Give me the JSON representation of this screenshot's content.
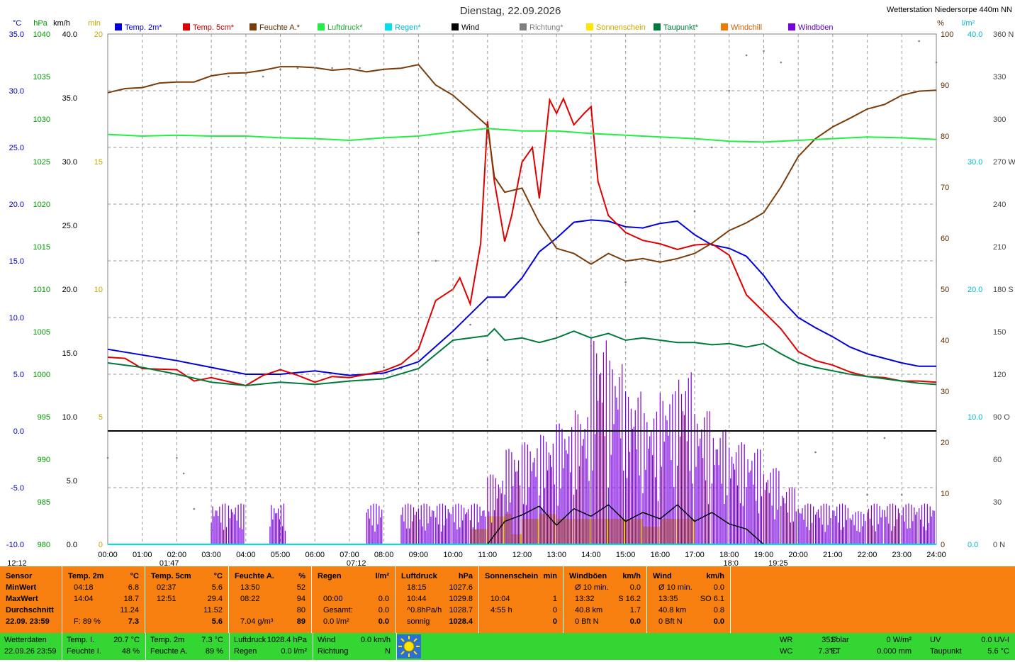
{
  "title": "Dienstag, 22.09.2026",
  "station": "Wetterstation Niedersorpe 440m NN",
  "axis_units": {
    "temp": "°C",
    "pressure": "hPa",
    "wind": "km/h",
    "sun": "min",
    "humidity": "%",
    "rain": "l/m²",
    "direction": "N"
  },
  "axis_ticks": {
    "temp": [
      "35.0",
      "30.0",
      "25.0",
      "20.0",
      "15.0",
      "10.0",
      "5.0",
      "0.0",
      "-5.0",
      "-10.0"
    ],
    "pressure": [
      "1040",
      "1035",
      "1030",
      "1025",
      "1020",
      "1015",
      "1010",
      "1005",
      "1000",
      "995",
      "990",
      "985",
      "980"
    ],
    "wind": [
      "40.0",
      "35.0",
      "30.0",
      "25.0",
      "20.0",
      "15.0",
      "10.0",
      "5.0",
      "0.0"
    ],
    "sun": [
      "20",
      "15",
      "10",
      "5",
      "0"
    ],
    "humidity": [
      "100",
      "90",
      "80",
      "70",
      "60",
      "50",
      "40",
      "30",
      "20",
      "10",
      "0"
    ],
    "rain": [
      "40.0",
      "30.0",
      "20.0",
      "10.0",
      "0.0"
    ],
    "direction": [
      "360 N",
      "330",
      "300",
      "270 W",
      "240",
      "210",
      "180 S",
      "150",
      "120",
      "90 O",
      "60",
      "30",
      "0 N"
    ]
  },
  "legend": [
    {
      "name": "Temp. 2m*",
      "color": "#0000dd"
    },
    {
      "name": "Temp. 5cm*",
      "color": "#e00000"
    },
    {
      "name": "Feuchte A.*",
      "color": "#7a3c0a"
    },
    {
      "name": "Luftdruck*",
      "color": "#22ee44"
    },
    {
      "name": "Regen*",
      "color": "#00e0f0"
    },
    {
      "name": "Wind",
      "color": "#000000"
    },
    {
      "name": "Richtung*",
      "color": "#808080"
    },
    {
      "name": "Sonnenschein",
      "color": "#ffe600"
    },
    {
      "name": "Taupunkt*",
      "color": "#007a3a"
    },
    {
      "name": "Windchill",
      "color": "#f07a00"
    },
    {
      "name": "Windböen",
      "color": "#7a00e0"
    }
  ],
  "time_labels": [
    "00:00",
    "01:00",
    "02:00",
    "03:00",
    "04:00",
    "05:00",
    "06:00",
    "07:00",
    "08:00",
    "09:00",
    "10:00",
    "11:00",
    "12:00",
    "13:00",
    "14:00",
    "15:00",
    "16:00",
    "17:00",
    "18:00",
    "19:00",
    "20:00",
    "21:00",
    "22:00",
    "23:00",
    "24:00"
  ],
  "events": [
    {
      "label": "12:12",
      "hour": -2.2
    },
    {
      "label": "01:47",
      "hour": 1.78
    },
    {
      "label": "07:12",
      "hour": 7.2
    },
    {
      "label": "18:0",
      "hour": 18.05
    },
    {
      "label": "19:25",
      "hour": 19.42
    }
  ],
  "chart_data": {
    "type": "line",
    "x_range": [
      0,
      24
    ],
    "ranges": {
      "temp": [
        -10,
        35
      ],
      "pressure": [
        980,
        1040
      ],
      "wind": [
        0,
        40
      ],
      "sun": [
        0,
        20
      ],
      "humidity": [
        0,
        100
      ],
      "rain": [
        0,
        40
      ],
      "direction": [
        0,
        360
      ]
    },
    "series": [
      {
        "name": "Temp. 2m*",
        "axis": "temp",
        "color": "#0000dd",
        "x": [
          0,
          1,
          2,
          3,
          4,
          5,
          6,
          7,
          8,
          9,
          10,
          11,
          11.5,
          12,
          12.5,
          13,
          13.5,
          14,
          14.5,
          15,
          15.5,
          16,
          16.5,
          17,
          17.5,
          18,
          18.5,
          19,
          19.5,
          20,
          20.5,
          21,
          21.5,
          22,
          22.5,
          23,
          23.5,
          24
        ],
        "y": [
          7.2,
          6.7,
          6.2,
          5.6,
          5.0,
          5.0,
          5.3,
          4.9,
          5.1,
          6.1,
          8.8,
          11.8,
          11.8,
          13.5,
          15.8,
          17.0,
          18.4,
          18.6,
          18.5,
          18.0,
          17.9,
          18.3,
          18.5,
          17.3,
          16.4,
          16.1,
          15.4,
          13.7,
          11.6,
          10.0,
          9.1,
          8.3,
          7.4,
          6.8,
          6.4,
          6.0,
          5.7,
          5.7
        ]
      },
      {
        "name": "Temp. 5cm*",
        "axis": "temp",
        "color": "#e00000",
        "x": [
          0,
          0.5,
          1,
          2,
          2.5,
          3,
          4,
          4.5,
          5,
          5.5,
          6,
          6.5,
          7,
          8,
          8.5,
          9,
          9.5,
          10,
          10.2,
          10.5,
          10.8,
          11,
          11.2,
          11.5,
          11.7,
          12,
          12.3,
          12.5,
          12.8,
          13,
          13.2,
          13.5,
          13.8,
          14,
          14.2,
          14.5,
          15,
          15.5,
          16,
          16.5,
          17,
          17.5,
          18,
          18.5,
          19,
          19.5,
          20,
          20.5,
          21,
          21.5,
          22,
          22.5,
          23,
          23.5,
          24
        ],
        "y": [
          6.5,
          6.4,
          5.5,
          5.4,
          4.4,
          4.7,
          4.0,
          4.9,
          5.4,
          4.9,
          4.3,
          4.8,
          4.7,
          5.3,
          5.9,
          7.2,
          11.5,
          12.5,
          13.5,
          11.2,
          16.5,
          27.3,
          22.0,
          16.7,
          19.0,
          23.7,
          25.0,
          20.5,
          29.2,
          28.0,
          29.3,
          27.0,
          28.0,
          28.6,
          22.0,
          19.0,
          17.5,
          16.8,
          16.5,
          16.0,
          16.4,
          16.5,
          15.5,
          12.0,
          10.5,
          9.0,
          7.0,
          6.2,
          5.8,
          5.2,
          4.8,
          4.7,
          4.4,
          4.4,
          4.3
        ]
      },
      {
        "name": "Feuchte A.*",
        "axis": "humidity",
        "color": "#7a3c0a",
        "x": [
          0,
          0.5,
          1,
          1.5,
          2,
          2.5,
          3,
          3.5,
          4,
          4.5,
          5,
          5.5,
          6,
          6.5,
          7,
          7.5,
          8,
          8.5,
          9,
          9.5,
          10,
          10.5,
          11,
          11.2,
          11.5,
          12,
          12.5,
          13,
          13.5,
          14,
          14.5,
          15,
          15.5,
          16,
          16.5,
          17,
          17.5,
          18,
          18.5,
          19,
          19.5,
          20,
          20.5,
          21,
          21.5,
          22,
          22.5,
          23,
          23.5,
          24
        ],
        "y": [
          88.5,
          89.3,
          89.5,
          90.4,
          90.6,
          90.6,
          91.8,
          92.3,
          92.4,
          92.9,
          93.6,
          93.6,
          93.4,
          92.9,
          93.2,
          92.6,
          93.1,
          93.3,
          94.0,
          90.0,
          88.0,
          85.0,
          82.0,
          72.0,
          69.0,
          69.8,
          63.0,
          58.0,
          57.0,
          54.9,
          57.0,
          55.5,
          56.0,
          55.3,
          56.0,
          57.0,
          59.0,
          61.5,
          63.0,
          65.0,
          70.0,
          76.0,
          79.5,
          81.8,
          83.5,
          85.3,
          86.2,
          88.0,
          88.8,
          89.0
        ]
      },
      {
        "name": "Luftdruck*",
        "axis": "pressure",
        "color": "#22ee44",
        "x": [
          0,
          1,
          2,
          3,
          4,
          5,
          6,
          7,
          8,
          9,
          10,
          11,
          12,
          13,
          14,
          15,
          16,
          17,
          18,
          19,
          20,
          21,
          22,
          23,
          24
        ],
        "y": [
          1028.2,
          1028.0,
          1028.1,
          1028.0,
          1028.0,
          1027.8,
          1027.7,
          1027.5,
          1027.8,
          1028.0,
          1028.5,
          1028.9,
          1028.6,
          1028.6,
          1028.3,
          1028.1,
          1027.9,
          1027.7,
          1027.4,
          1027.3,
          1027.5,
          1027.7,
          1027.9,
          1027.8,
          1027.6
        ]
      },
      {
        "name": "Taupunkt*",
        "axis": "temp",
        "color": "#007a3a",
        "x": [
          0,
          1,
          2,
          3,
          4,
          5,
          6,
          7,
          8,
          9,
          10,
          11,
          11.2,
          11.5,
          12,
          12.5,
          13,
          13.5,
          14,
          14.5,
          15,
          15.5,
          16,
          16.5,
          17,
          17.5,
          18,
          18.5,
          19,
          19.5,
          20,
          20.5,
          21,
          21.5,
          22,
          22.5,
          23,
          23.5,
          24
        ],
        "y": [
          6.0,
          5.6,
          5.0,
          4.3,
          4.0,
          4.3,
          4.1,
          4.4,
          4.6,
          5.5,
          8.0,
          8.4,
          9.0,
          8.0,
          8.2,
          7.8,
          8.2,
          8.8,
          8.2,
          8.6,
          8.0,
          8.2,
          8.0,
          7.8,
          7.8,
          7.6,
          7.7,
          7.4,
          7.7,
          6.8,
          6.0,
          5.6,
          5.3,
          5.0,
          4.8,
          4.6,
          4.4,
          4.2,
          4.1
        ]
      },
      {
        "name": "Wind",
        "axis": "wind",
        "color": "#000000",
        "x": [
          0,
          11,
          11.5,
          12,
          12.5,
          13,
          13.5,
          14,
          14.5,
          15,
          15.5,
          16,
          16.5,
          17,
          17.5,
          18,
          18.5,
          19,
          24
        ],
        "y": [
          0,
          0,
          1.8,
          2.3,
          3.0,
          1.5,
          2.8,
          2.2,
          3.1,
          1.8,
          2.5,
          2.0,
          3.1,
          1.8,
          2.5,
          1.6,
          1.2,
          0,
          0
        ]
      },
      {
        "name": "Regen*",
        "axis": "rain",
        "color": "#00e0f0",
        "x": [
          0,
          24
        ],
        "y": [
          0,
          0
        ]
      },
      {
        "name": "Richtung*",
        "axis": "direction",
        "color": "#808080",
        "x": [
          0,
          2,
          2.2,
          2.5,
          3,
          3.5,
          4,
          4.5,
          5,
          5.5,
          6,
          6.5,
          7.3,
          8,
          8.5,
          9,
          9.5,
          10,
          10.5,
          11,
          12,
          13,
          14,
          15,
          16,
          17,
          17.5,
          18,
          18.5,
          19,
          19.5,
          20,
          20.5,
          21,
          21.5,
          22,
          22.5,
          23,
          23.5,
          24
        ],
        "y": [
          61,
          61,
          50,
          25,
          10,
          330,
          332,
          330,
          335,
          336,
          336,
          336,
          336,
          125,
          124,
          220,
          200,
          180,
          155,
          130,
          200,
          160,
          140,
          185,
          205,
          235,
          280,
          320,
          345,
          348,
          340,
          80,
          65,
          20,
          120,
          35,
          75,
          35,
          355,
          340
        ]
      },
      {
        "name": "Sonnenschein",
        "axis": "sun",
        "color": "#ffe600",
        "x": [
          10.5,
          11,
          11.5,
          11.7,
          12,
          12.5,
          13,
          13.5,
          14,
          14.5,
          15,
          15.5,
          16,
          16.5,
          17
        ],
        "y": [
          0.6,
          1.1,
          1.2,
          0.4,
          1.0,
          1.2,
          1.0,
          1.0,
          1.0,
          1.0,
          1.0,
          0.7,
          1.0,
          1.0,
          0
        ]
      },
      {
        "name": "Windböen",
        "axis": "wind",
        "color": "#7a00e0",
        "x": [
          3,
          3.5,
          4.7,
          7.5,
          8.5,
          9,
          9.5,
          10,
          10.5,
          11,
          11.5,
          12,
          12.5,
          13,
          13.5,
          14,
          14.5,
          15,
          15.5,
          16,
          16.5,
          17,
          17.5,
          18,
          18.5,
          19,
          19.5,
          20,
          20.5,
          21,
          21.5,
          22,
          22.5,
          23,
          23.5
        ],
        "y": [
          3.2,
          3.2,
          3.2,
          3.2,
          3.2,
          3.2,
          3.2,
          3.2,
          3.2,
          5.5,
          7.5,
          8.0,
          8.6,
          9.5,
          10.5,
          16.2,
          14.5,
          12.0,
          10.5,
          12.0,
          13.5,
          10.5,
          9.0,
          8.0,
          7.5,
          6.0,
          4.5,
          3.2,
          3.2,
          3.2,
          2.6,
          3.2,
          3.2,
          3.2,
          3.2
        ]
      }
    ]
  },
  "table": {
    "columns": [
      {
        "head": [
          "Sensor",
          ""
        ],
        "rows": [
          [
            "MinWert",
            ""
          ],
          [
            "MaxWert",
            ""
          ],
          [
            "Durchschnitt",
            ""
          ],
          [
            "22.09. 23:59",
            ""
          ]
        ]
      },
      {
        "head": [
          "Temp. 2m",
          "°C"
        ],
        "rows": [
          [
            "04:18",
            "6.8"
          ],
          [
            "14:04",
            "18.7"
          ],
          [
            "",
            "11.24"
          ],
          [
            "F: 89 %",
            "7.3"
          ]
        ]
      },
      {
        "head": [
          "Temp. 5cm",
          "°C"
        ],
        "rows": [
          [
            "02:37",
            "5.6"
          ],
          [
            "12:51",
            "29.4"
          ],
          [
            "",
            "11.52"
          ],
          [
            "",
            "5.6"
          ]
        ]
      },
      {
        "head": [
          "Feuchte A.",
          "%"
        ],
        "rows": [
          [
            "13:50",
            "52"
          ],
          [
            "08:22",
            "94"
          ],
          [
            "",
            "80"
          ],
          [
            "7.04 g/m³",
            "89"
          ]
        ]
      },
      {
        "head": [
          "Regen",
          "l/m²"
        ],
        "rows": [
          [
            "",
            ""
          ],
          [
            "00:00",
            "0.0"
          ],
          [
            "Gesamt:",
            "0.0"
          ],
          [
            "0.0 l/m²",
            "0.0"
          ]
        ]
      },
      {
        "head": [
          "Luftdruck",
          "hPa"
        ],
        "rows": [
          [
            "18:15",
            "1027.6"
          ],
          [
            "10:44",
            "1029.8"
          ],
          [
            "^0.8hPa/h",
            "1028.7"
          ],
          [
            "sonnig",
            "1028.4"
          ]
        ]
      },
      {
        "head": [
          "Sonnenschein",
          "min"
        ],
        "rows": [
          [
            "",
            ""
          ],
          [
            "10:04",
            "1"
          ],
          [
            "4:55 h",
            "0"
          ],
          [
            "",
            "0"
          ]
        ]
      },
      {
        "head": [
          "Windböen",
          "km/h"
        ],
        "rows": [
          [
            "Ø 10 min.",
            "0.0"
          ],
          [
            "13:32",
            "S 16.2"
          ],
          [
            "40.8 km",
            "1.7"
          ],
          [
            "0 Bft N",
            "0.0"
          ]
        ]
      },
      {
        "head": [
          "Wind",
          "km/h"
        ],
        "rows": [
          [
            "Ø 10 min.",
            "0.0"
          ],
          [
            "13:35",
            "SO 6.1"
          ],
          [
            "40.8 km",
            "0.8"
          ],
          [
            "0 Bft N",
            "0.0"
          ]
        ]
      }
    ]
  },
  "footer": {
    "station_label": "Wetterdaten",
    "station_time": "22.09.26 23:59",
    "items": [
      {
        "label": "Temp. I.",
        "value": "20.7 °C"
      },
      {
        "label": "Feuchte I.",
        "value": "48 %"
      },
      {
        "label": "Temp. 2m",
        "value": "7.3 °C"
      },
      {
        "label": "Feuchte A.",
        "value": "89 %"
      },
      {
        "label": "Luftdruck",
        "value": "1028.4 hPa"
      },
      {
        "label": "Regen",
        "value": "0.0 l/m²"
      },
      {
        "label": "Wind",
        "value": "0.0 km/h"
      },
      {
        "label": "Richtung",
        "value": "N"
      },
      {
        "label": "WR",
        "value": "351°"
      },
      {
        "label": "WC",
        "value": "7.3°C"
      },
      {
        "label": "Solar",
        "value": "0 W/m²"
      },
      {
        "label": "ET",
        "value": "0.000 mm"
      },
      {
        "label": "UV",
        "value": "0.0 UV-I"
      },
      {
        "label": "Taupunkt",
        "value": "5.6 °C"
      }
    ]
  }
}
